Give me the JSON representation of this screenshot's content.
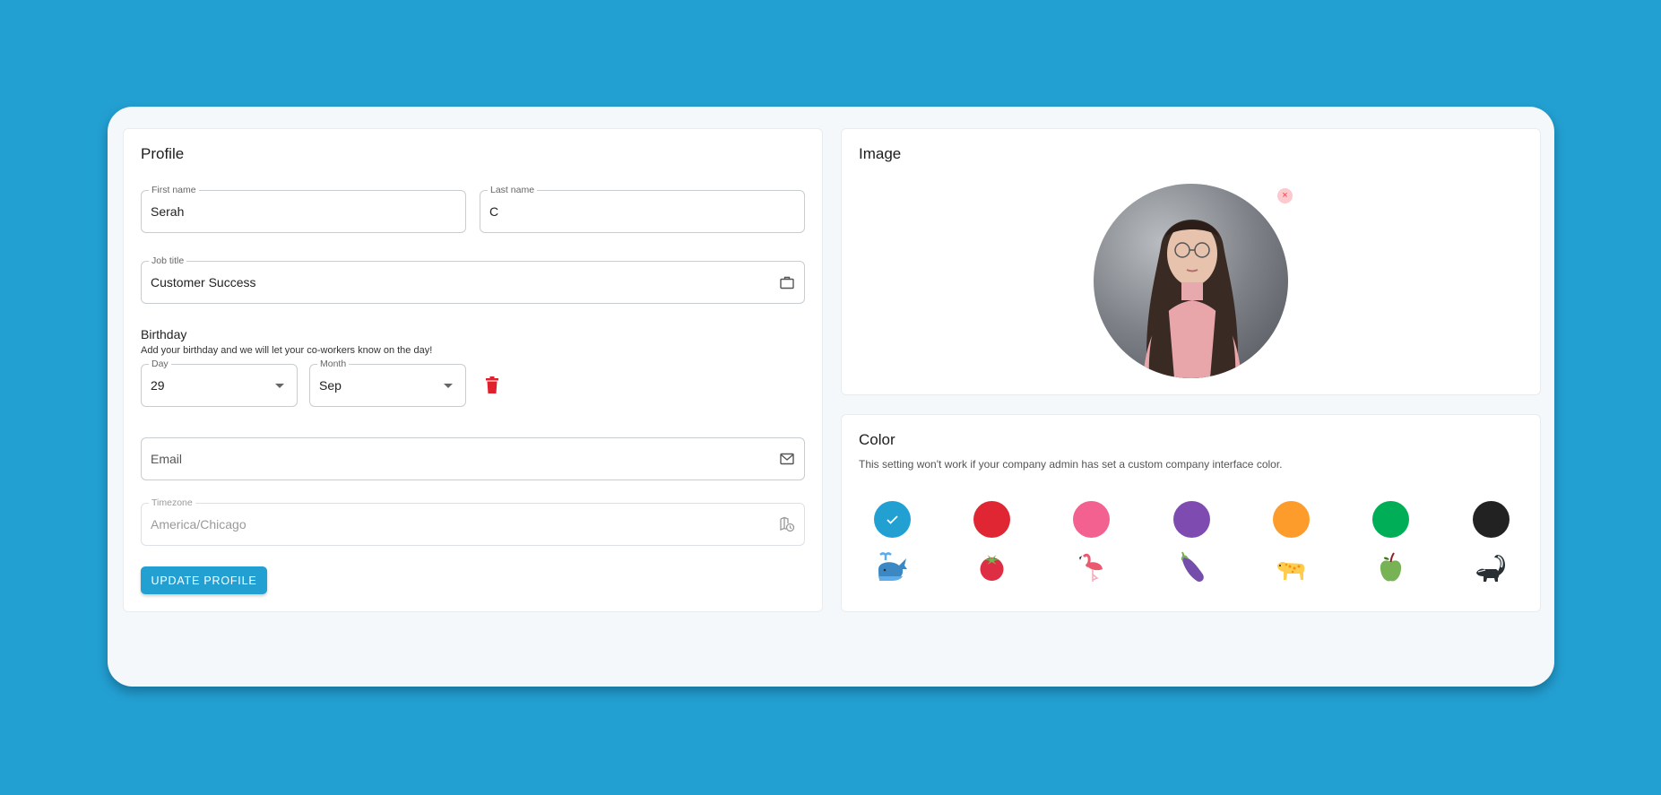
{
  "profile": {
    "title": "Profile",
    "first_name": {
      "label": "First name",
      "value": "Serah"
    },
    "last_name": {
      "label": "Last name",
      "value": "C"
    },
    "job_title": {
      "label": "Job title",
      "value": "Customer Success",
      "icon": "briefcase-icon"
    },
    "birthday": {
      "title": "Birthday",
      "subtitle": "Add your birthday and we will let your co-workers know on the day!",
      "day": {
        "label": "Day",
        "value": "29"
      },
      "month": {
        "label": "Month",
        "value": "Sep"
      },
      "delete_icon": "trash-icon"
    },
    "email": {
      "placeholder": "Email",
      "value": "",
      "icon": "mail-icon"
    },
    "timezone": {
      "label": "Timezone",
      "value": "America/Chicago",
      "icon": "map-clock-icon"
    },
    "update_button": "UPDATE PROFILE"
  },
  "image": {
    "title": "Image",
    "remove_label": "×",
    "avatar_alt": "Profile photo"
  },
  "color": {
    "title": "Color",
    "subtitle": "This setting won't work if your company admin has set a custom company interface color.",
    "selected_index": 0,
    "options": [
      {
        "name": "blue",
        "hex": "#23a0d2",
        "emoji": "whale"
      },
      {
        "name": "red",
        "hex": "#e02633",
        "emoji": "tomato"
      },
      {
        "name": "pink",
        "hex": "#f26190",
        "emoji": "flamingo"
      },
      {
        "name": "purple",
        "hex": "#7e4cb1",
        "emoji": "eggplant"
      },
      {
        "name": "orange",
        "hex": "#fd9c2b",
        "emoji": "leopard"
      },
      {
        "name": "green",
        "hex": "#00ae58",
        "emoji": "green-apple"
      },
      {
        "name": "black",
        "hex": "#222222",
        "emoji": "skunk"
      }
    ]
  },
  "colors": {
    "background": "#23a0d2",
    "accent": "#23a0d2",
    "danger": "#e0202d"
  }
}
